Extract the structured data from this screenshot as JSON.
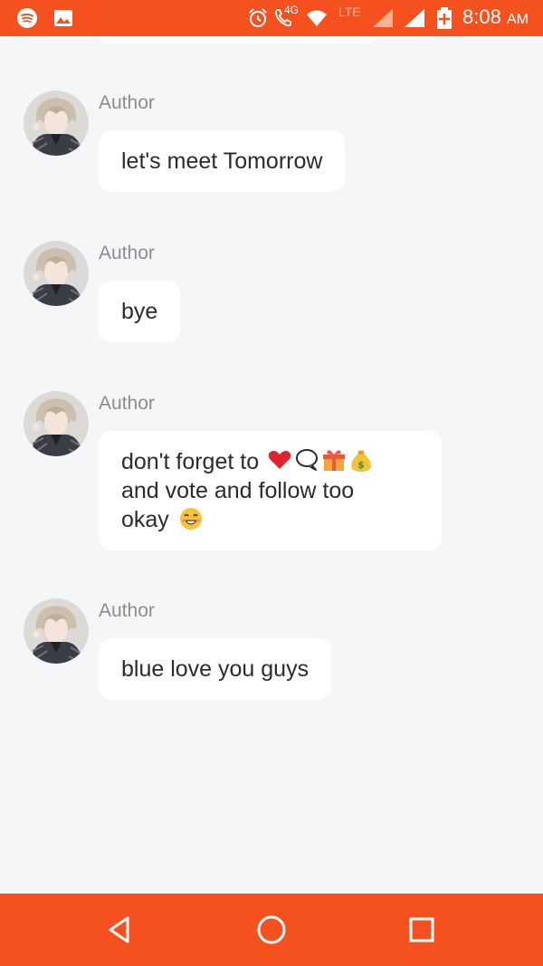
{
  "status_bar": {
    "time": "8:08",
    "ampm": "AM",
    "network": "4G",
    "lte": "LTE",
    "icons": [
      "spotify-icon",
      "gallery-icon",
      "alarm-icon",
      "volte-call-icon",
      "wifi-icon",
      "signal-icon",
      "battery-charging-icon"
    ]
  },
  "messages": [
    {
      "author": "Author",
      "text": "let's meet Tomorrow"
    },
    {
      "author": "Author",
      "text": "bye"
    },
    {
      "author": "Author",
      "text": "don't forget to ",
      "text2": "and vote and follow too\nokay ",
      "emojis": [
        "heart-emoji",
        "speech-bubble-emoji",
        "gift-emoji",
        "money-bag-emoji",
        "smiling-face-emoji"
      ]
    },
    {
      "author": "Author",
      "text": "blue love you guys"
    }
  ],
  "nav_bar": {
    "buttons": [
      "back-button",
      "home-button",
      "recents-button"
    ]
  },
  "colors": {
    "accent": "#f4511e",
    "background": "#f5f6f8",
    "bubble": "#ffffff",
    "author": "#8b8d91",
    "text": "#2b2b2b"
  }
}
